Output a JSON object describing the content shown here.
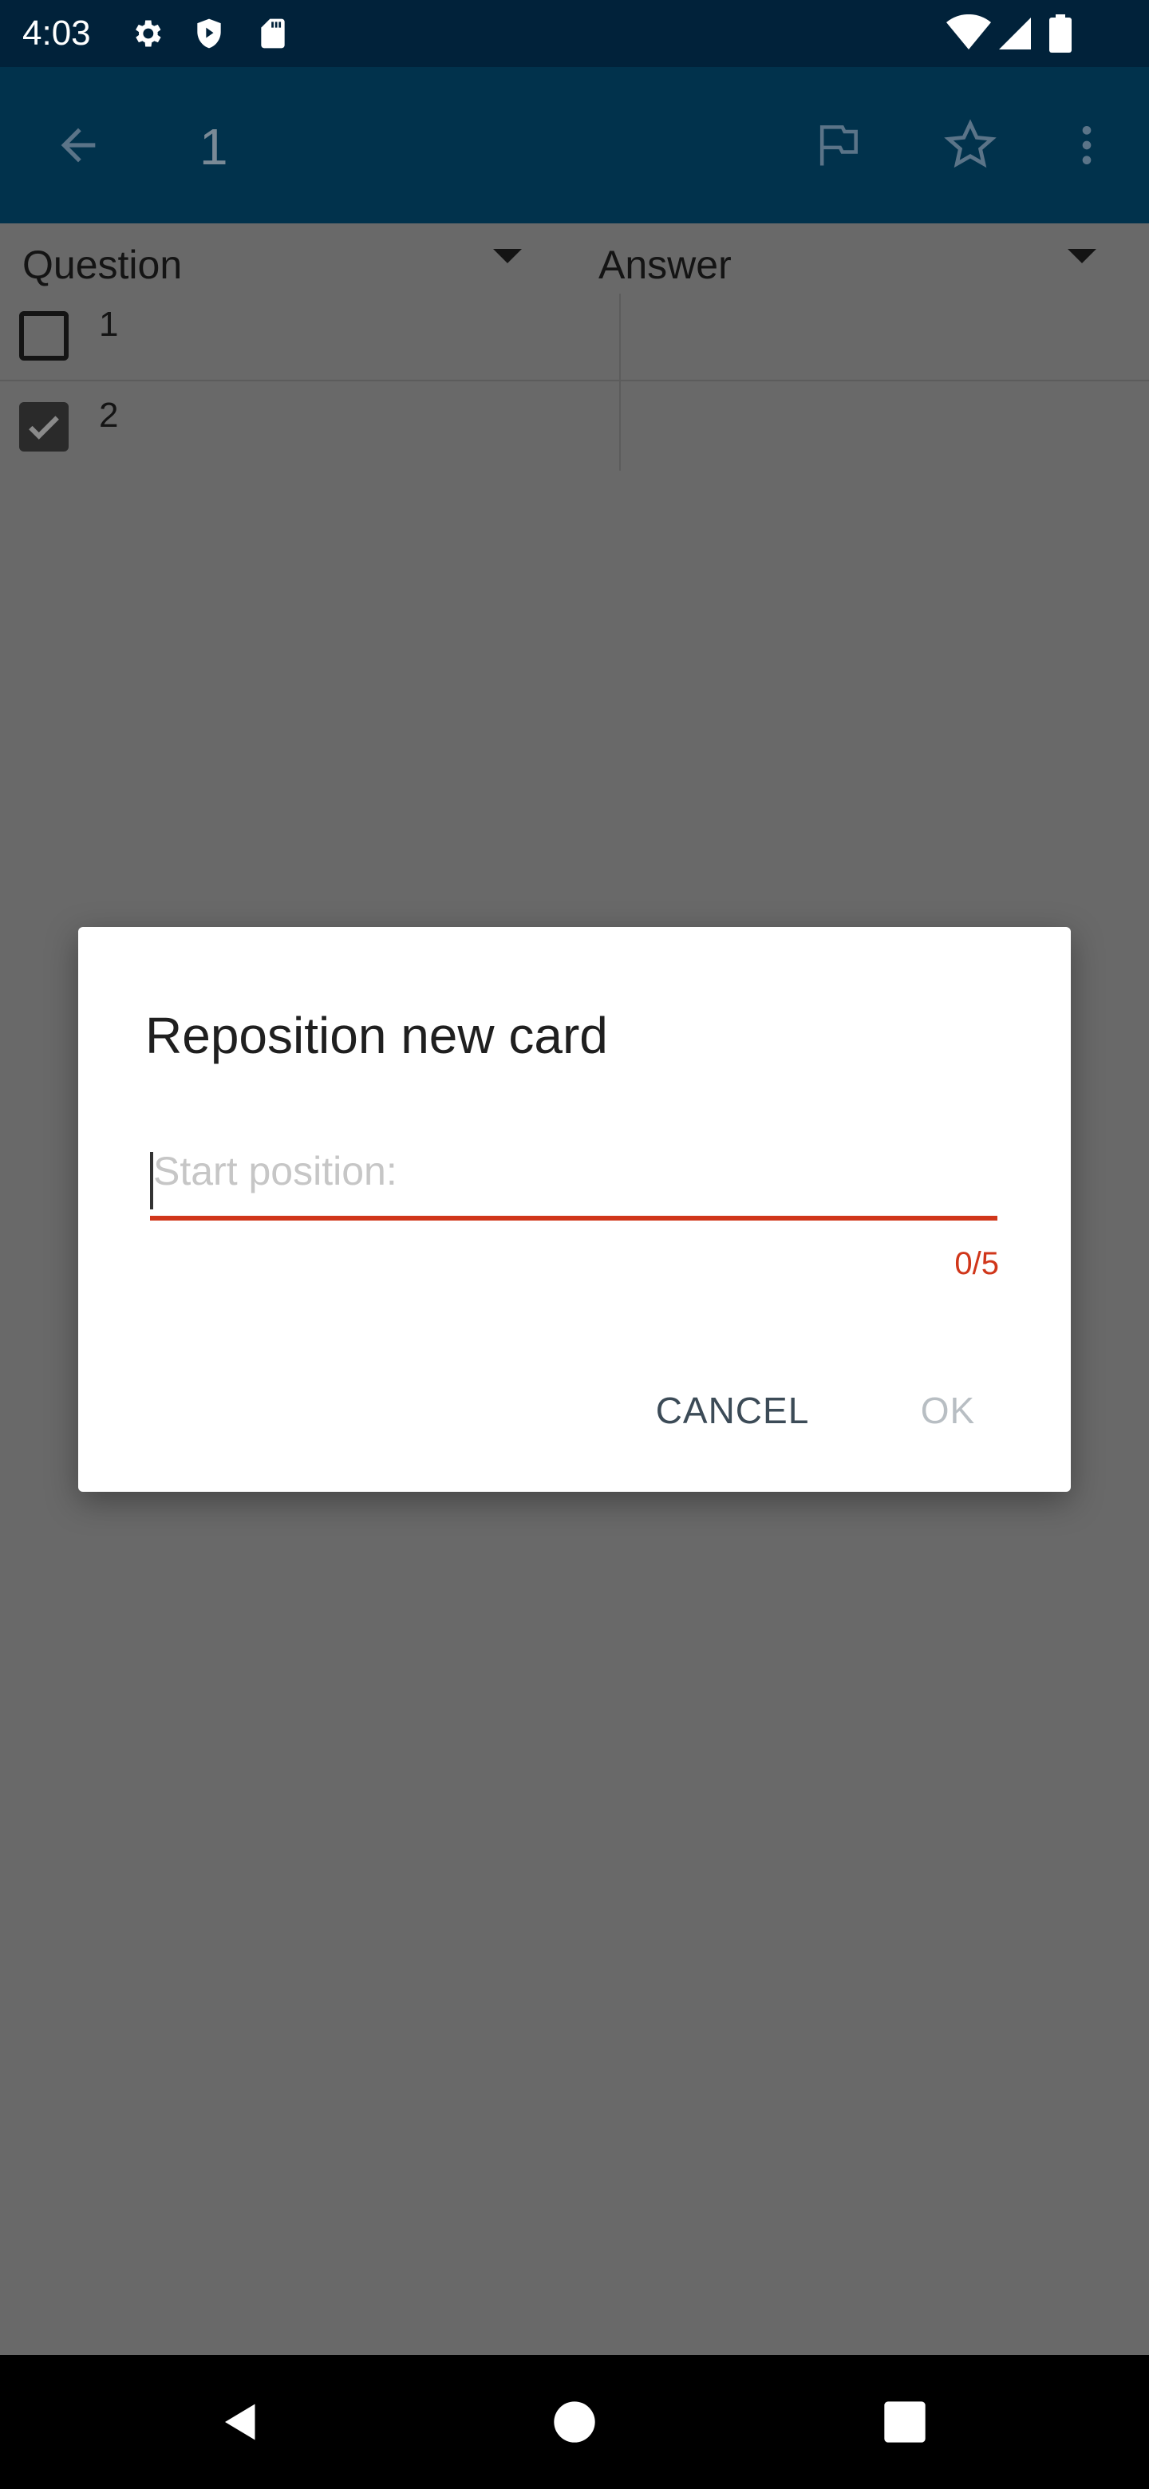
{
  "status_bar": {
    "time": "4:03",
    "icons": [
      "gear-icon",
      "shield-play-icon",
      "sd-card-icon",
      "wifi-icon",
      "signal-icon",
      "battery-icon"
    ]
  },
  "app_bar": {
    "title": "1",
    "icons": [
      "back-arrow-icon",
      "flag-icon",
      "star-icon",
      "more-vert-icon"
    ]
  },
  "columns": {
    "question_label": "Question",
    "answer_label": "Answer"
  },
  "rows": [
    {
      "question": "1",
      "answer": "",
      "checked": false
    },
    {
      "question": "2",
      "answer": "",
      "checked": true
    }
  ],
  "dialog": {
    "title": "Reposition new card",
    "input_placeholder": "Start position:",
    "input_value": "",
    "counter": "0/5",
    "cancel_label": "CANCEL",
    "ok_label": "OK"
  },
  "nav_bar": {
    "icons": [
      "back-triangle-icon",
      "home-circle-icon",
      "recents-square-icon"
    ]
  },
  "colors": {
    "status_bar_bg": "#01223a",
    "app_bar_bg": "#01324c",
    "scrim": "#696969",
    "accent_error": "#d0361a"
  }
}
